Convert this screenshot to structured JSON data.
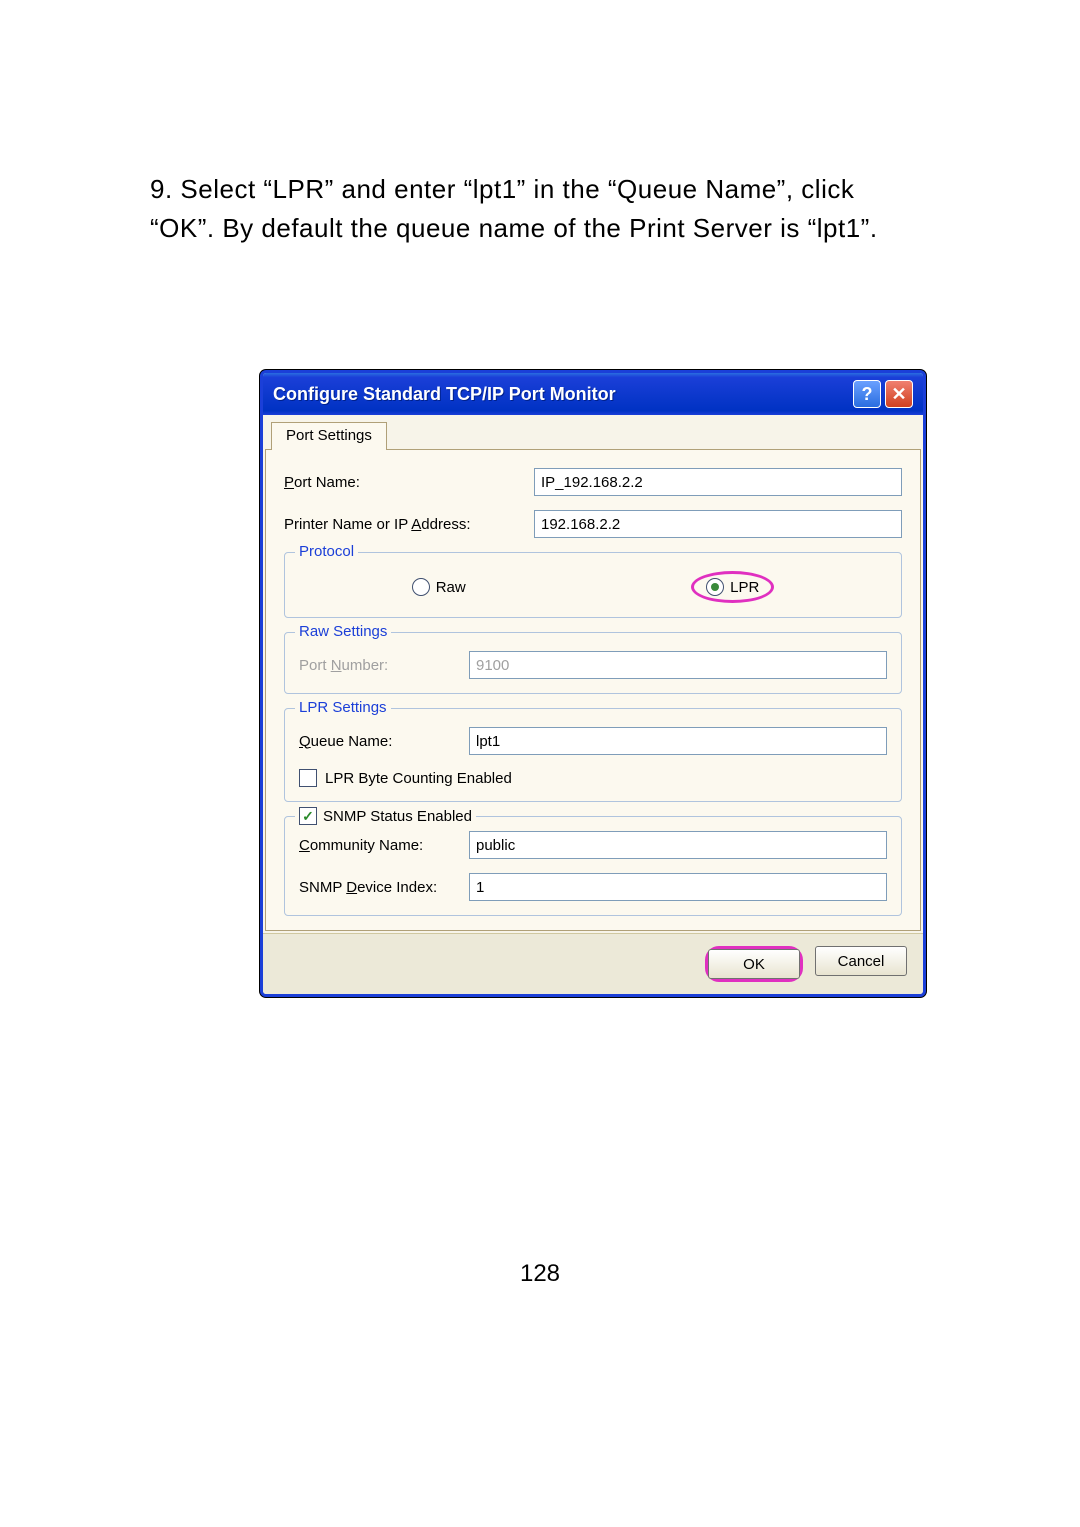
{
  "instruction": "9. Select “LPR” and enter “lpt1” in the “Queue Name”, click “OK”. By default the queue name of the Print Server is “lpt1”.",
  "dialog": {
    "title": "Configure Standard TCP/IP Port Monitor",
    "tab": "Port Settings",
    "port_name_label": "Port Name:",
    "port_name_value": "IP_192.168.2.2",
    "printer_name_label_pre": "Printer Name or IP ",
    "printer_name_label_u": "A",
    "printer_name_label_post": "ddress:",
    "printer_name_value": "192.168.2.2",
    "protocol_legend": "Protocol",
    "radio_raw_u": "R",
    "radio_raw": "aw",
    "radio_lpr_u": "L",
    "radio_lpr": "PR",
    "raw_legend": "Raw Settings",
    "raw_port_label_pre": "Port ",
    "raw_port_label_u": "N",
    "raw_port_label_post": "umber:",
    "raw_port_value": "9100",
    "lpr_legend": "LPR Settings",
    "lpr_queue_label_u": "Q",
    "lpr_queue_label": "ueue Name:",
    "lpr_queue_value": "lpt1",
    "lpr_byte_pre": "LPR ",
    "lpr_byte_u": "B",
    "lpr_byte_post": "yte Counting Enabled",
    "snmp_label_u": "S",
    "snmp_label": "NMP Status Enabled",
    "community_label_u": "C",
    "community_label": "ommunity Name:",
    "community_value": "public",
    "device_label_pre": "SNMP ",
    "device_label_u": "D",
    "device_label_post": "evice Index:",
    "device_value": "1",
    "ok": "OK",
    "cancel": "Cancel"
  },
  "page_number": "128"
}
